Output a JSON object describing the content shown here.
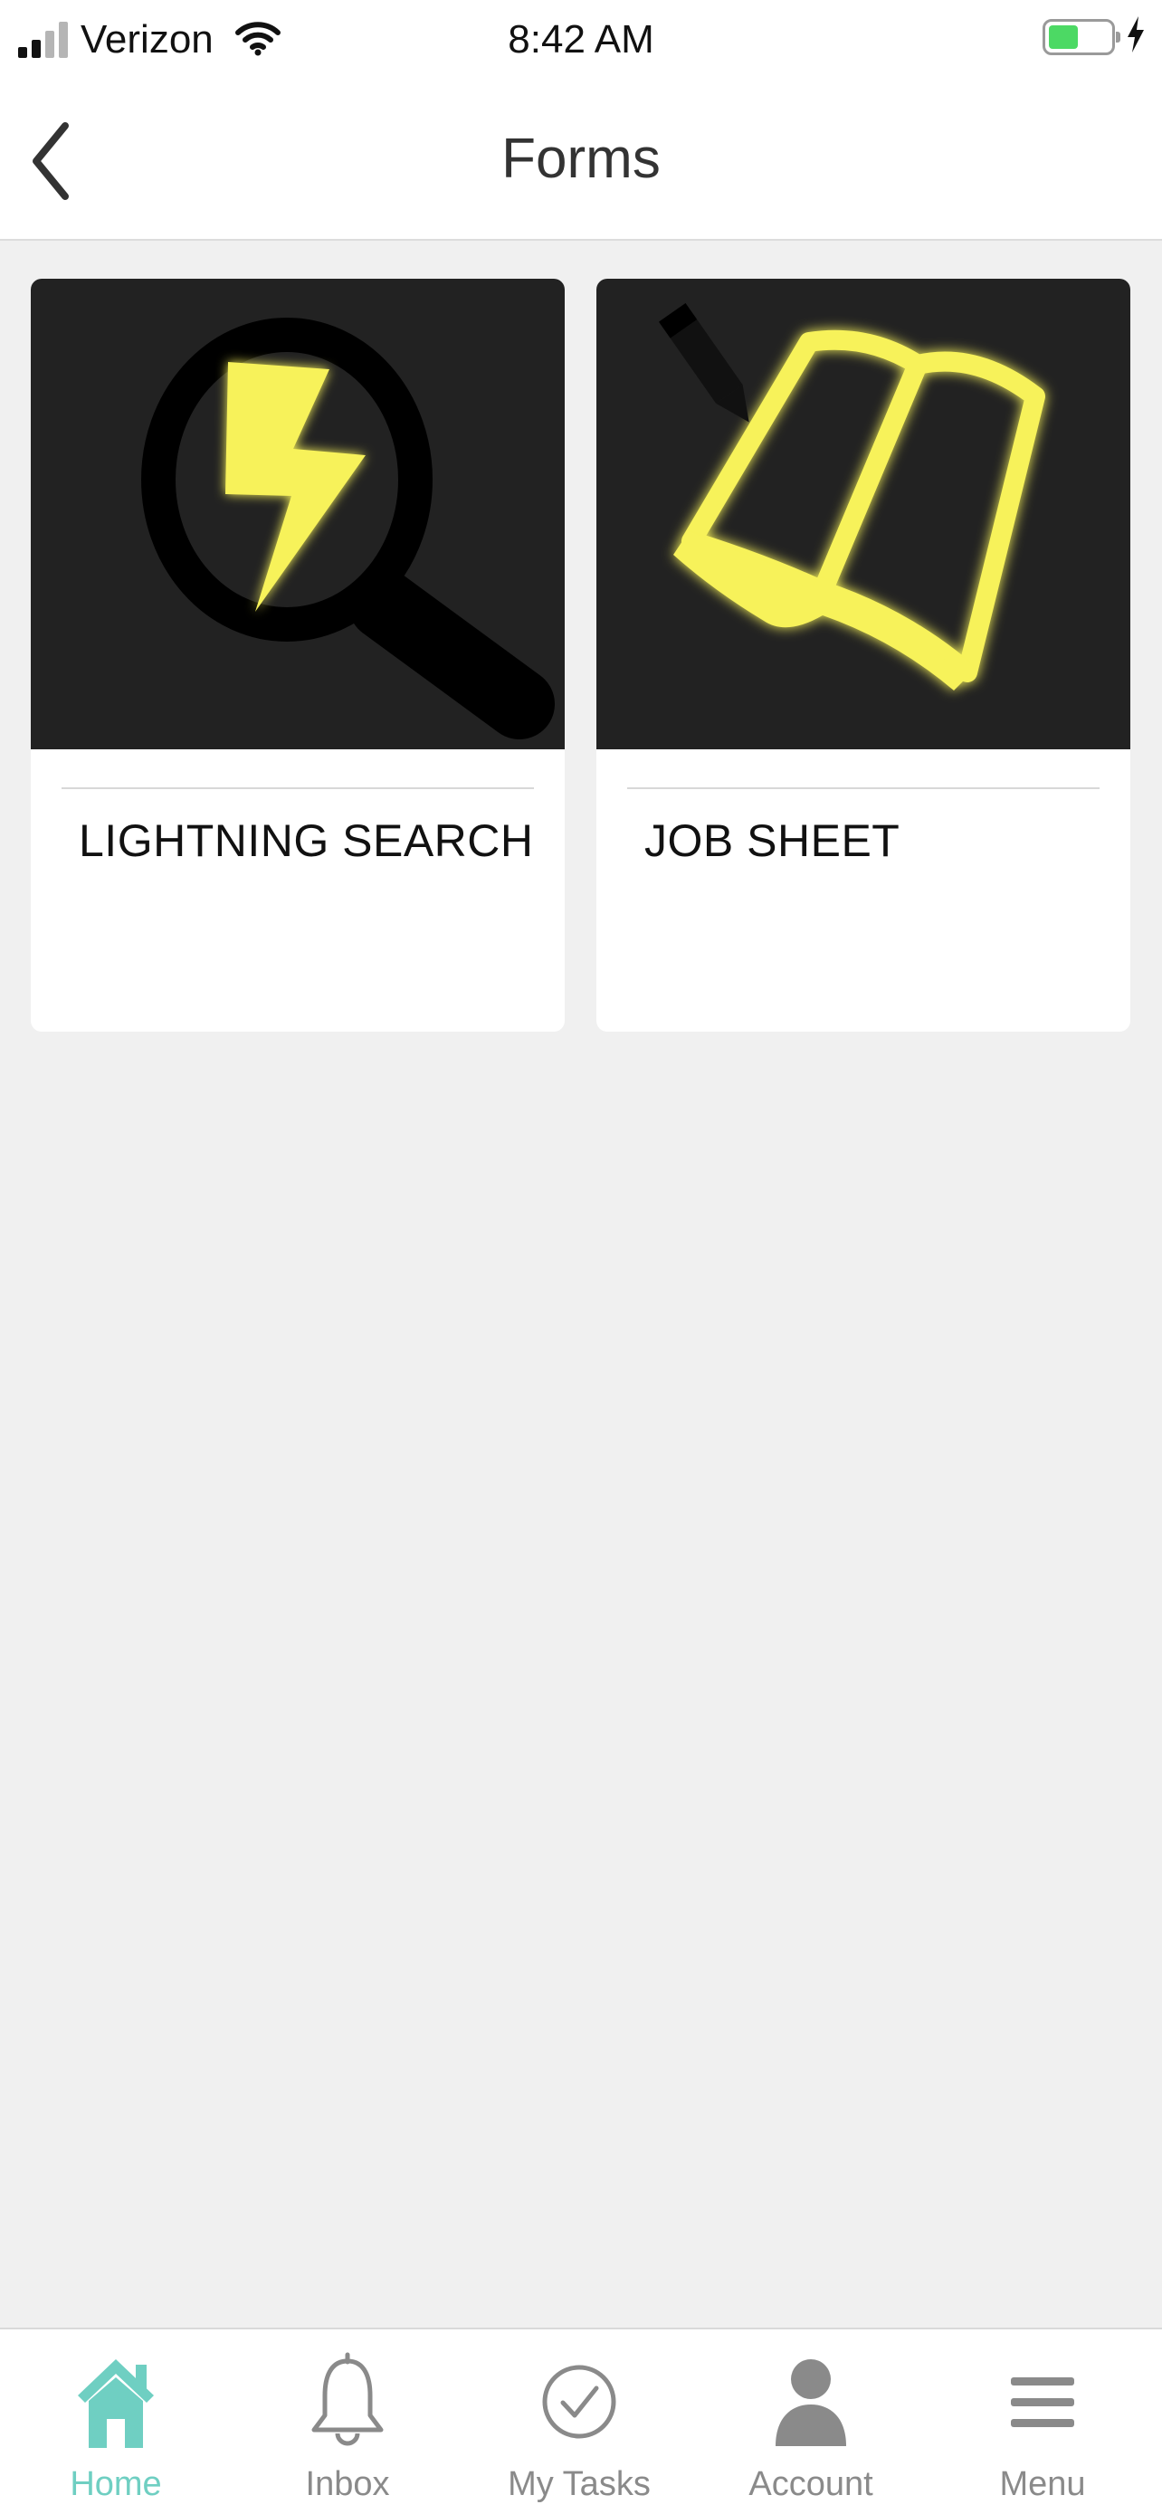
{
  "status_bar": {
    "carrier": "Verizon",
    "time": "8:42 AM",
    "battery_color": "#4cd964"
  },
  "header": {
    "title": "Forms",
    "back_icon": "chevron-left-icon"
  },
  "forms": [
    {
      "label": "LIGHTNING SEARCH",
      "icon": "lightning-search-icon"
    },
    {
      "label": "JOB SHEET",
      "icon": "job-sheet-book-icon"
    }
  ],
  "tab_bar": {
    "accent_color": "#6fcfc2",
    "inactive_color": "#8a8a8a",
    "tabs": [
      {
        "label": "Home",
        "icon": "home-icon",
        "active": true
      },
      {
        "label": "Inbox",
        "icon": "bell-icon",
        "active": false
      },
      {
        "label": "My Tasks",
        "icon": "checkmark-circle-icon",
        "active": false
      },
      {
        "label": "Account",
        "icon": "person-icon",
        "active": false
      },
      {
        "label": "Menu",
        "icon": "hamburger-menu-icon",
        "active": false
      }
    ]
  }
}
